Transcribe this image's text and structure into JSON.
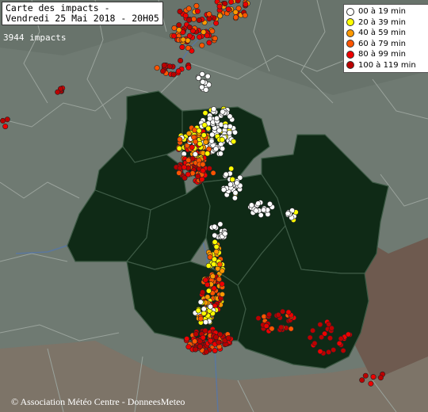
{
  "header": {
    "title_line1": "Carte des impacts -",
    "title_line2": "Vendredi 25 Mai 2018 - 20H05",
    "impacts": "3944 impacts"
  },
  "footer": {
    "copyright": "© Association Météo Centre - DonneesMeteo"
  },
  "legend": {
    "items": [
      {
        "label": "00 à 19 min",
        "color": "#ffffff"
      },
      {
        "label": "20 à 39 min",
        "color": "#ffff00"
      },
      {
        "label": "40 à 59 min",
        "color": "#ff9900"
      },
      {
        "label": "60 à 79 min",
        "color": "#ff5500"
      },
      {
        "label": "80 à 99 min",
        "color": "#ee0000"
      },
      {
        "label": "100 à 119 min",
        "color": "#bb0000"
      }
    ]
  },
  "colors": {
    "background": "#6f7a72",
    "region": "#0f2a16",
    "borders": "#9aa39c",
    "rivers": "#5577aa"
  }
}
